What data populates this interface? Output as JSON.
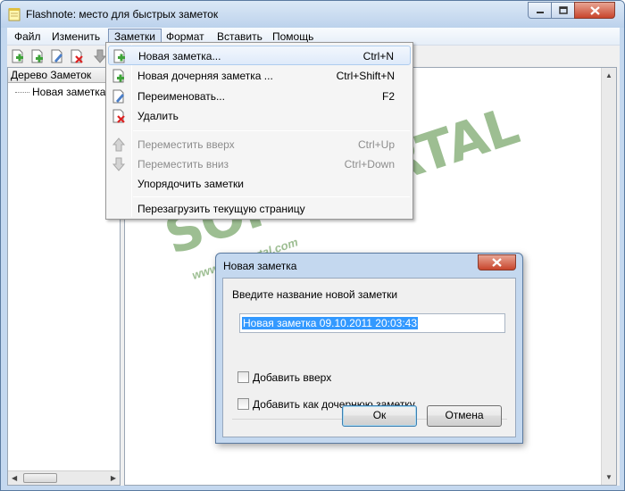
{
  "window": {
    "title": "Flashnote: место для быстрых заметок"
  },
  "menubar": {
    "items": [
      "Файл",
      "Изменить",
      "Заметки",
      "Формат",
      "Вставить",
      "Помощь"
    ],
    "open_item": "Заметки"
  },
  "tree": {
    "header": "Дерево Заметок",
    "items": [
      "Новая заметка"
    ]
  },
  "dropdown": {
    "items": [
      {
        "label": "Новая заметка...",
        "shortcut": "Ctrl+N",
        "icon": "new-note-icon",
        "disabled": false,
        "highlighted": true
      },
      {
        "label": "Новая дочерняя заметка ...",
        "shortcut": "Ctrl+Shift+N",
        "icon": "new-child-note-icon",
        "disabled": false
      },
      {
        "label": "Переименовать...",
        "shortcut": "F2",
        "icon": "rename-icon",
        "disabled": false
      },
      {
        "label": "Удалить",
        "shortcut": "",
        "icon": "delete-note-icon",
        "disabled": false
      },
      {
        "label": "Переместить вверх",
        "shortcut": "Ctrl+Up",
        "icon": "arrow-up-icon",
        "disabled": true
      },
      {
        "label": "Переместить вниз",
        "shortcut": "Ctrl+Down",
        "icon": "arrow-down-icon",
        "disabled": true
      },
      {
        "label": "Упорядочить заметки",
        "shortcut": "",
        "icon": "",
        "disabled": false
      },
      {
        "label": "Перезагрузить текущую страницу",
        "shortcut": "",
        "icon": "",
        "disabled": false
      }
    ]
  },
  "dialog": {
    "title": "Новая заметка",
    "prompt": "Введите название новой заметки",
    "input_value": "Новая заметка 09.10.2011 20:03:43",
    "checkbox_add_top": "Добавить вверх",
    "checkbox_add_child": "Добавить как дочернюю заметку",
    "ok_label": "Ок",
    "cancel_label": "Отмена"
  },
  "watermark": {
    "main": "SOFTPORTAL",
    "tm": "™",
    "sub": "www.softportal.com"
  },
  "colors": {
    "title_bar": "#c4d8ef",
    "close_button": "#c8452c",
    "selection": "#3399ff",
    "watermark": "#4e8a3a"
  }
}
